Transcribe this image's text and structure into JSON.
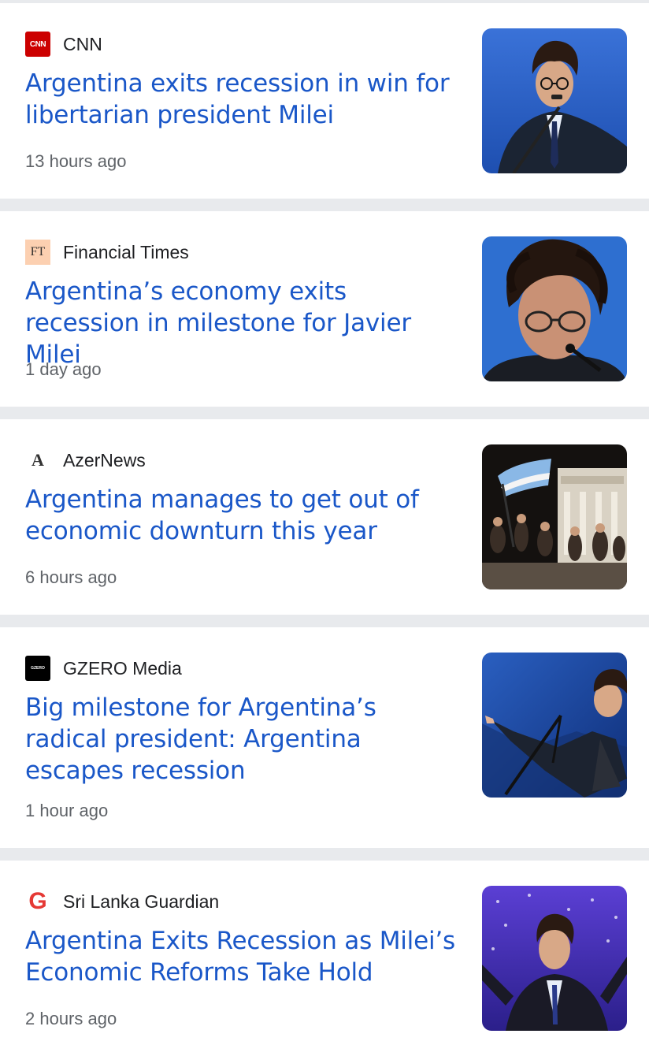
{
  "articles": [
    {
      "source": "CNN",
      "logo_icon": "cnn-logo-icon",
      "logo_text": "CNN",
      "headline": "Argentina exits recession in win for libertarian president Milei",
      "time": "13 hours ago"
    },
    {
      "source": "Financial Times",
      "logo_icon": "ft-logo-icon",
      "logo_text": "FT",
      "headline": "Argentina’s economy exits recession in milestone for Javier Milei",
      "time": "1 day ago"
    },
    {
      "source": "AzerNews",
      "logo_icon": "azernews-logo-icon",
      "logo_text": "A",
      "headline": "Argentina manages to get out of economic downturn this year",
      "time": "6 hours ago"
    },
    {
      "source": "GZERO Media",
      "logo_icon": "gzero-logo-icon",
      "logo_text": "GZERO",
      "headline": "Big milestone for Argentina’s radical president: Argentina escapes recession",
      "time": "1 hour ago"
    },
    {
      "source": "Sri Lanka Guardian",
      "logo_icon": "sri-lanka-guardian-logo-icon",
      "logo_text": "G",
      "headline": "Argentina Exits Recession as Milei’s Economic Reforms Take Hold",
      "time": "2 hours ago"
    }
  ],
  "colors": {
    "headline": "#1a57c8",
    "source": "#202124",
    "time": "#5f6368",
    "divider": "#e8eaed",
    "cnn_red": "#cc0000",
    "ft_pink": "#fcd0b1",
    "guardian_red": "#e53935"
  }
}
